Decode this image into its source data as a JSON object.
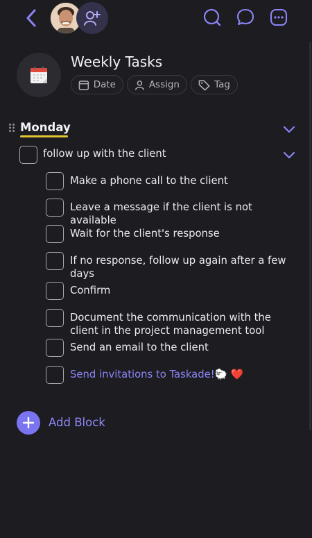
{
  "header": {
    "title": "Weekly Tasks",
    "chips": [
      {
        "label": "Date",
        "icon": "calendar-icon"
      },
      {
        "label": "Assign",
        "icon": "person-icon"
      },
      {
        "label": "Tag",
        "icon": "tag-icon"
      }
    ]
  },
  "section": {
    "title": "Monday",
    "parent_task": "follow up with the client",
    "subtasks": [
      "Make a phone call to the client",
      "Leave a message if the client is not available",
      "Wait for the client's response",
      "If no response, follow up again after a few days",
      "Confirm",
      "Document the communication with the client in the project management tool",
      "Send an email to the client",
      "Send invitations to Taskade!🐑 ❤️"
    ]
  },
  "footer": {
    "add_block_label": "Add Block"
  },
  "colors": {
    "background": "#1c1c21",
    "accent": "#7b74f0",
    "link": "#8b85f5",
    "underline": "#e3c534"
  }
}
